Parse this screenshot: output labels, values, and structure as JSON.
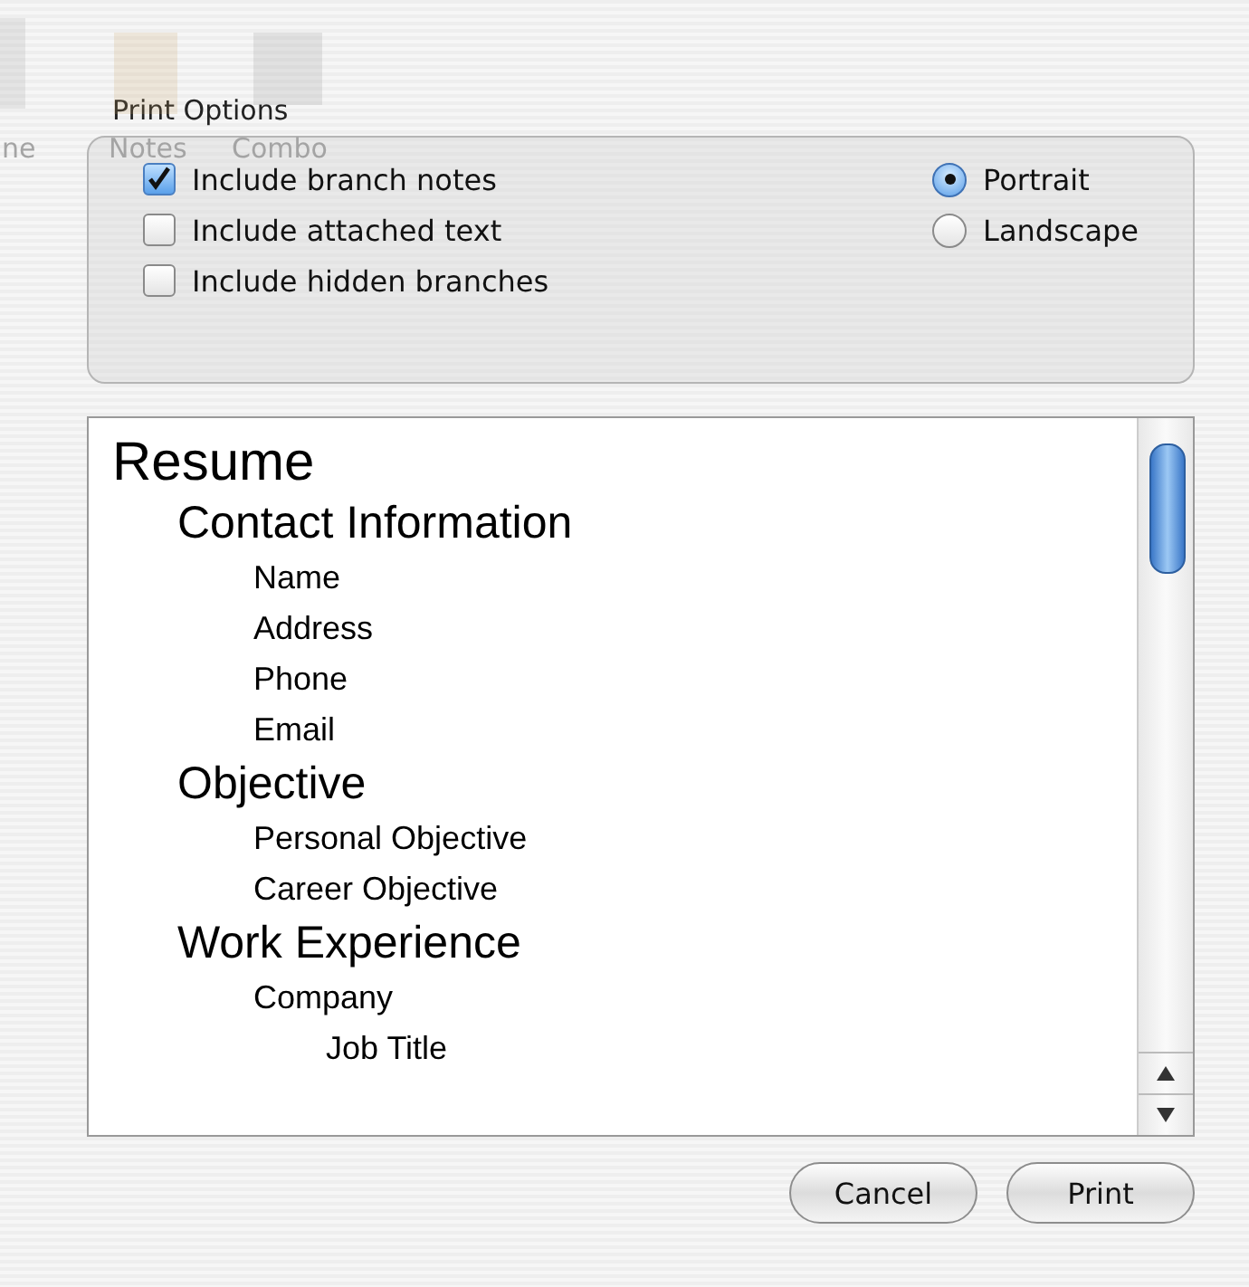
{
  "background_toolbar": [
    "ne",
    "Notes",
    "Combo"
  ],
  "print_options": {
    "title": "Print Options",
    "checkboxes": [
      {
        "label": "Include branch notes",
        "checked": true
      },
      {
        "label": "Include attached text",
        "checked": false
      },
      {
        "label": "Include hidden branches",
        "checked": false
      }
    ],
    "orientation": [
      {
        "label": "Portrait",
        "selected": true
      },
      {
        "label": "Landscape",
        "selected": false
      }
    ]
  },
  "outline": [
    {
      "text": "Resume",
      "children": [
        {
          "text": "Contact Information",
          "children": [
            {
              "text": "Name"
            },
            {
              "text": "Address"
            },
            {
              "text": "Phone"
            },
            {
              "text": "Email"
            }
          ]
        },
        {
          "text": "Objective",
          "children": [
            {
              "text": "Personal Objective"
            },
            {
              "text": "Career Objective"
            }
          ]
        },
        {
          "text": "Work Experience",
          "children": [
            {
              "text": "Company",
              "children": [
                {
                  "text": "Job Title"
                }
              ]
            }
          ]
        }
      ]
    }
  ],
  "buttons": [
    "Cancel",
    "Print"
  ]
}
